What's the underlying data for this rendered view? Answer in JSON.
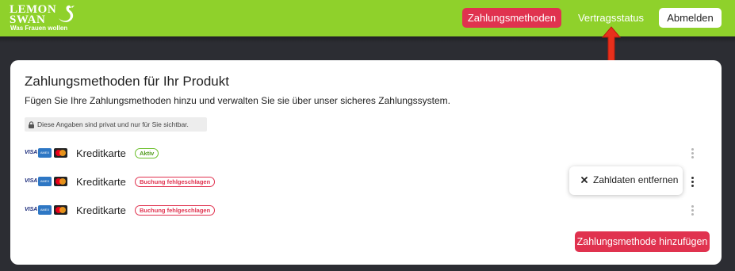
{
  "header": {
    "logo": {
      "line1": "LEMON",
      "line2": "SWAN",
      "tagline": "Was Frauen wollen"
    },
    "nav": {
      "payment_methods": "Zahlungsmethoden",
      "contract_status": "Vertragsstatus",
      "logout": "Abmelden"
    }
  },
  "card": {
    "title": "Zahlungsmethoden für Ihr Produkt",
    "description": "Fügen Sie Ihre Zahlungsmethoden hinzu und verwalten Sie sie über unser sicheres Zahlungssystem.",
    "privacy_note": "Diese Angaben sind privat und nur für Sie sichtbar.",
    "payment_methods": [
      {
        "brands": [
          "VISA",
          "AMEX",
          "Mastercard"
        ],
        "label": "Kreditkarte",
        "status": "Aktiv",
        "status_type": "active"
      },
      {
        "brands": [
          "VISA",
          "AMEX",
          "Mastercard"
        ],
        "label": "Kreditkarte",
        "status": "Buchung fehlgeschlagen",
        "status_type": "failed"
      },
      {
        "brands": [
          "VISA",
          "AMEX",
          "Mastercard"
        ],
        "label": "Kreditkarte",
        "status": "Buchung fehlgeschlagen",
        "status_type": "failed"
      }
    ],
    "context_menu": {
      "remove_label": "Zahldaten entfernen"
    },
    "add_button": "Zahlungsmethode hinzufügen"
  },
  "brand_labels": {
    "visa": "VISA",
    "amex": "AMEX"
  },
  "colors": {
    "header_green": "#8fd12b",
    "accent_red": "#e0324f",
    "active_green": "#6bbf2a",
    "background": "#2c2d33"
  }
}
